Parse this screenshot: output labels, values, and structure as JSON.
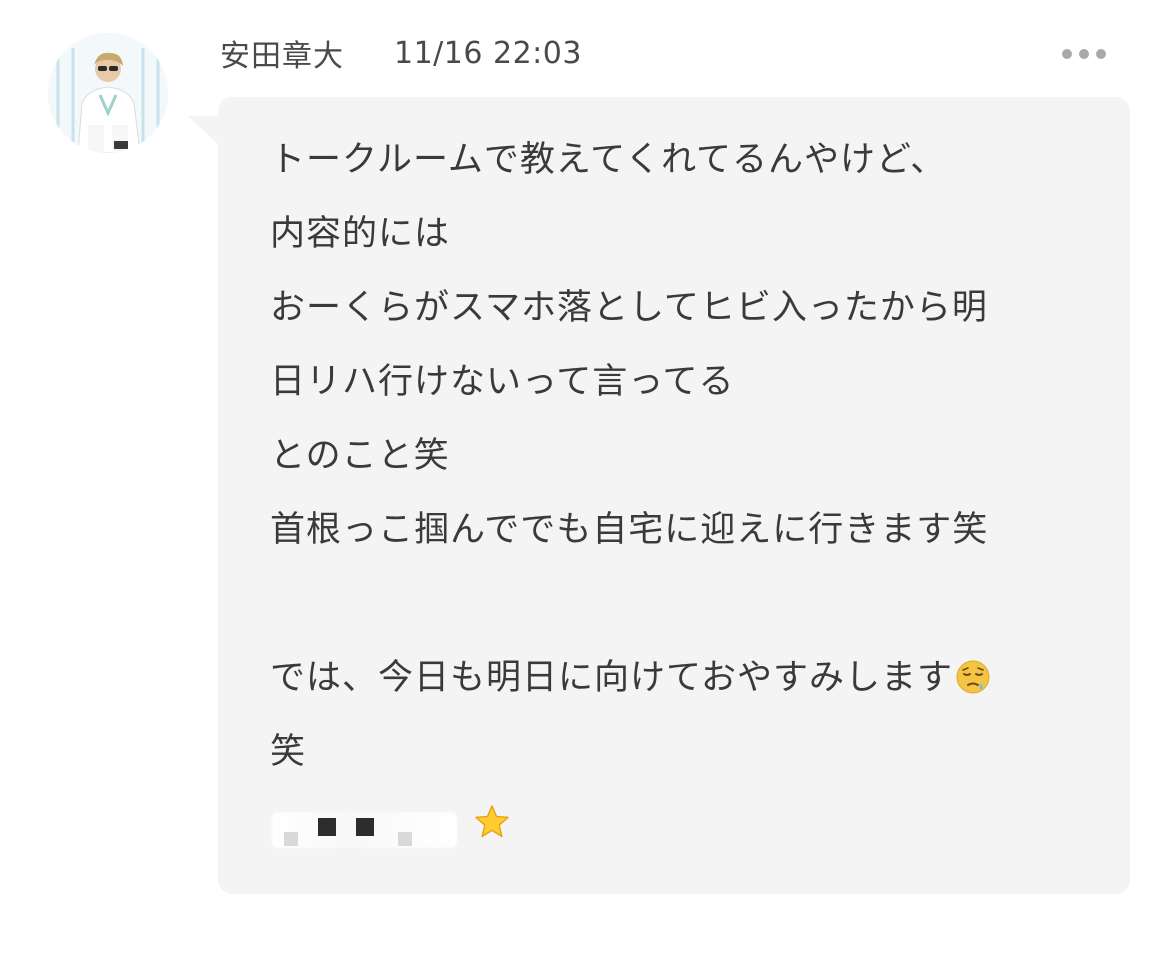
{
  "post": {
    "sender_name": "安田章大",
    "timestamp": "11/16 22:03",
    "more_icon": "more-horizontal-icon",
    "avatar_icon": "user-avatar-photo"
  },
  "message": {
    "lines": [
      "トークルームで教えてくれてるんやけど、",
      "内容的には",
      "おーくらがスマホ落としてヒビ入ったから明",
      "日リハ行けないって言ってる",
      "とのこと笑",
      "首根っこ掴んででも自宅に迎えに行きます笑",
      "",
      "では、今日も明日に向けておやすみします",
      "笑"
    ],
    "emoji_after_line_8": "sleepy-face-emoji",
    "signature_emoji": "star-emoji"
  },
  "colors": {
    "bubble_background": "#f4f4f4",
    "text": "#3a3a3a",
    "meta_text": "#4a4a4a",
    "more_dots": "#a9a9a9"
  }
}
